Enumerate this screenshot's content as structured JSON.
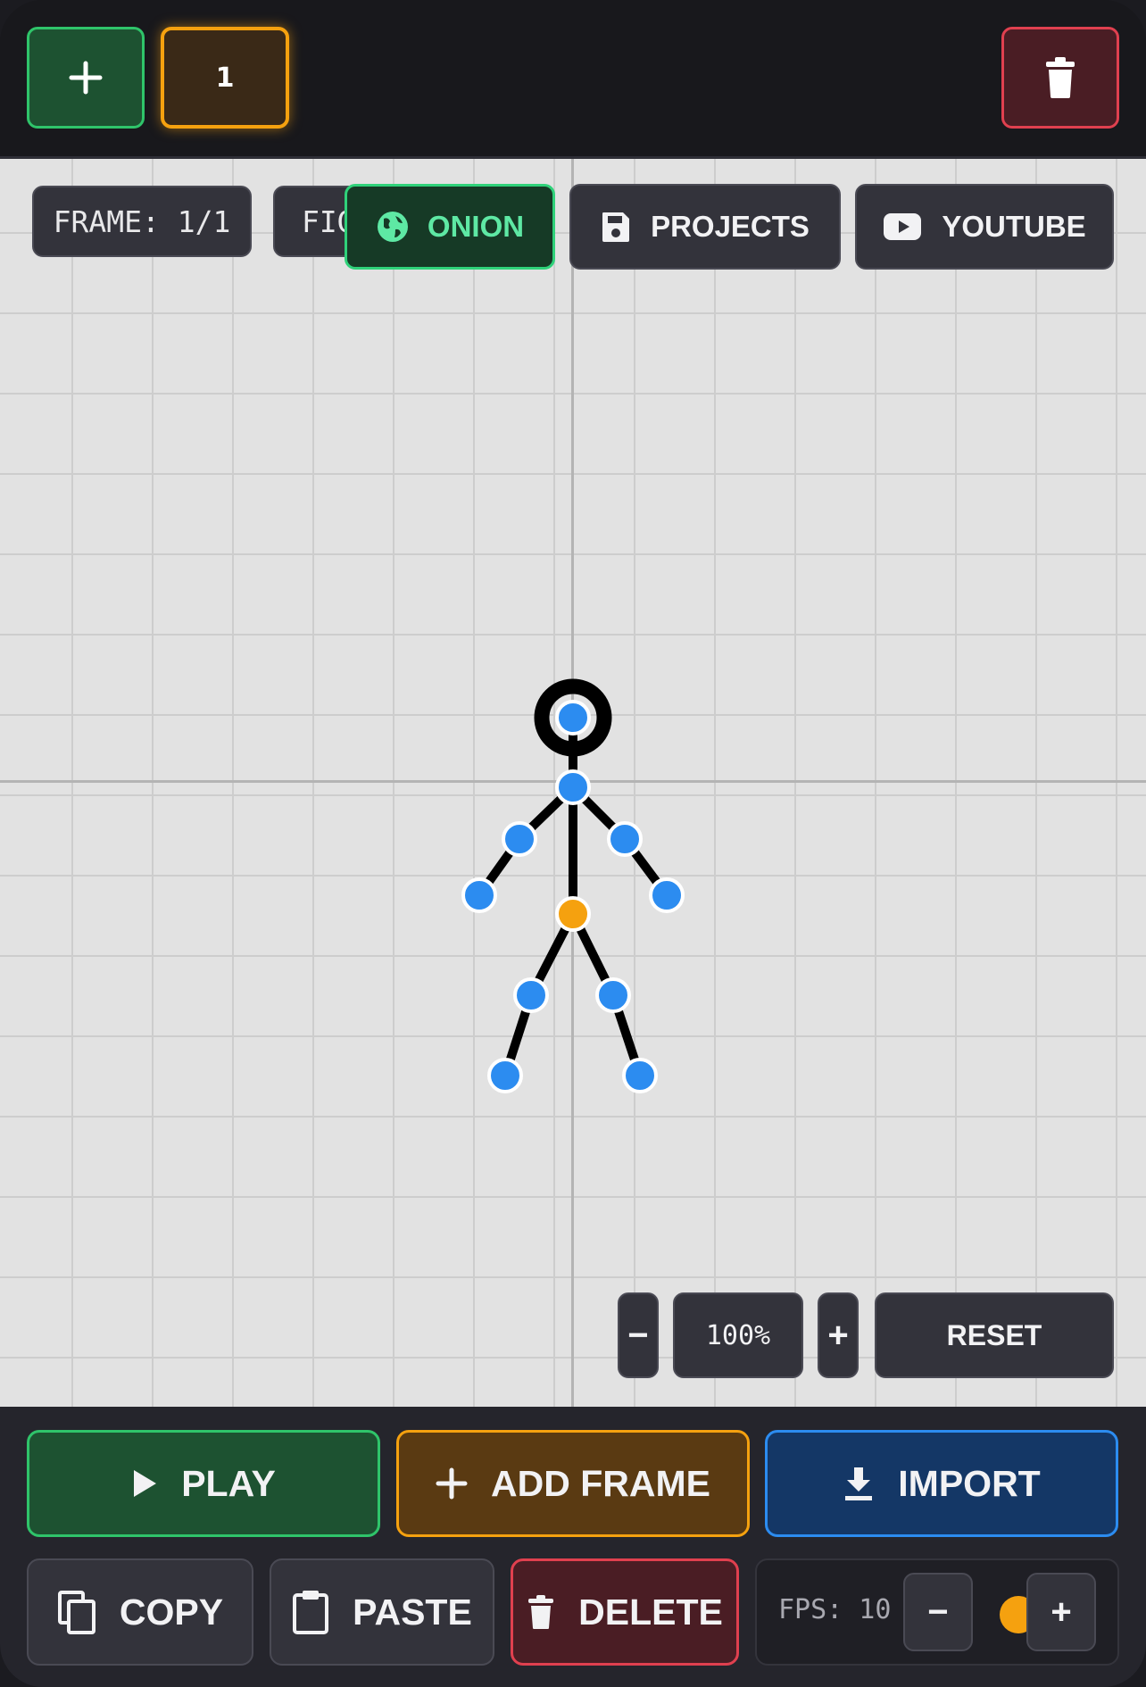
{
  "toolbar": {
    "add_label": "+",
    "frame_tab_label": "1"
  },
  "canvas": {
    "frame_indicator": "FRAME: 1/1",
    "figure_indicator": "FIG",
    "onion_label": "ONION",
    "projects_label": "PROJECTS",
    "youtube_label": "YOUTUBE",
    "zoom_out_label": "−",
    "zoom_level": "100%",
    "zoom_in_label": "+",
    "reset_label": "RESET"
  },
  "controls": {
    "play_label": "PLAY",
    "add_frame_label": "ADD FRAME",
    "import_label": "IMPORT",
    "copy_label": "COPY",
    "paste_label": "PASTE",
    "delete_label": "DELETE",
    "fps_label": "FPS: 10",
    "fps_minus_label": "−",
    "fps_plus_label": "+"
  },
  "colors": {
    "joint": "#2c8cf0",
    "root_joint": "#f5a10f",
    "bone": "#000000",
    "accent_green": "#2fc46a",
    "accent_orange": "#f5a10f",
    "accent_blue": "#2c8cf0",
    "accent_red": "#e0404f"
  },
  "icons": [
    "plus-icon",
    "trash-icon",
    "globe-icon",
    "save-icon",
    "youtube-icon",
    "play-icon",
    "download-icon",
    "copy-icon",
    "clipboard-icon"
  ]
}
